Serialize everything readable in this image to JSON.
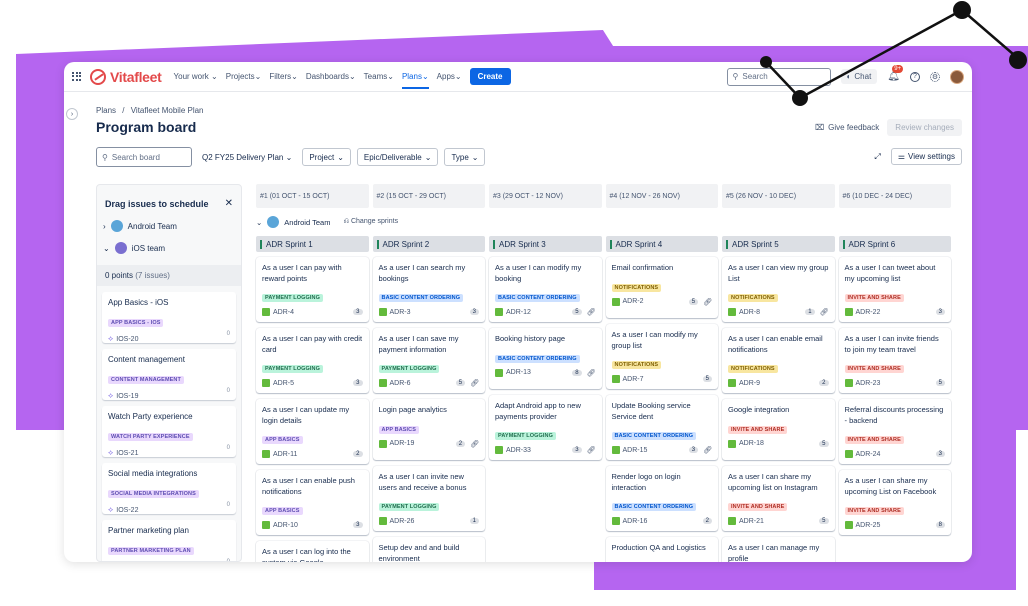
{
  "brand": {
    "name": "Vitafleet",
    "accent": "#e3494a",
    "primary": "#0c66e4",
    "backdrop": "#b565f0"
  },
  "nav": {
    "items": [
      "Your work",
      "Projects",
      "Filters",
      "Dashboards",
      "Teams",
      "Plans",
      "Apps"
    ],
    "active_index": 5,
    "create_label": "Create",
    "search_placeholder": "Search",
    "chat_label": "Chat",
    "notification_badge": "9+"
  },
  "breadcrumb": {
    "plans": "Plans",
    "separator": "/",
    "plan": "Vitafleet Mobile Plan"
  },
  "page_title": "Program board",
  "header_actions": {
    "feedback": "Give feedback",
    "review": "Review changes"
  },
  "filters": {
    "search_placeholder": "Search board",
    "plan": "Q2 FY25 Delivery Plan",
    "project": "Project",
    "epic": "Epic/Deliverable",
    "type": "Type",
    "view_settings": "View settings"
  },
  "sidebar": {
    "title": "Drag issues to schedule",
    "teams": [
      "Android Team",
      "iOS team"
    ],
    "points": "0 points",
    "issue_count": "(7 issues)",
    "issues": [
      {
        "title": "App Basics - iOS",
        "tag": "APP BASICS - IOS",
        "key": "IOS-20",
        "count": "0"
      },
      {
        "title": "Content management",
        "tag": "CONTENT MANAGEMENT",
        "key": "IOS-19",
        "count": "0"
      },
      {
        "title": "Watch Party experience",
        "tag": "WATCH PARTY EXPERIENCE",
        "key": "IOS-21",
        "count": "0"
      },
      {
        "title": "Social media integrations",
        "tag": "SOCIAL MEDIA INTEGRATIONS",
        "key": "IOS-22",
        "count": "0"
      },
      {
        "title": "Partner marketing plan",
        "tag": "PARTNER MARKETING PLAN",
        "key": "IOS-1",
        "count": "0"
      }
    ]
  },
  "board": {
    "sprint_ranges": [
      "#1 (01 OCT - 15 OCT)",
      "#2 (15 OCT - 29 OCT)",
      "#3 (29 OCT - 12 NOV)",
      "#4 (12 NOV - 26 NOV)",
      "#5 (26 NOV - 10 DEC)",
      "#6 (10 DEC - 24 DEC)"
    ],
    "team": "Android Team",
    "change_sprints": "Change sprints",
    "columns": [
      {
        "name": "ADR Sprint 1",
        "cards": [
          {
            "title": "As a user I can pay with reward points",
            "tag": "PAYMENT LOGGING",
            "color": "green",
            "key": "ADR-4",
            "pts": "3",
            "link": false
          },
          {
            "title": "As a user I can pay with credit card",
            "tag": "PAYMENT LOGGING",
            "color": "green",
            "key": "ADR-5",
            "pts": "3",
            "link": false
          },
          {
            "title": "As a user I can update my login details",
            "tag": "APP BASICS",
            "color": "purple",
            "key": "ADR-11",
            "pts": "2",
            "link": false
          },
          {
            "title": "As a user I can enable push notifications",
            "tag": "APP BASICS",
            "color": "purple",
            "key": "ADR-10",
            "pts": "3",
            "link": false
          },
          {
            "title": "As a user I can log into the system via Google",
            "tag": "",
            "color": "purple",
            "key": "",
            "pts": "",
            "link": false
          }
        ]
      },
      {
        "name": "ADR Sprint 2",
        "cards": [
          {
            "title": "As a user I can search my bookings",
            "tag": "BASIC CONTENT ORDERING",
            "color": "blue",
            "key": "ADR-3",
            "pts": "3",
            "link": false
          },
          {
            "title": "As a user I can save my payment information",
            "tag": "PAYMENT LOGGING",
            "color": "green",
            "key": "ADR-6",
            "pts": "5",
            "link": true
          },
          {
            "title": "Login page analytics",
            "tag": "APP BASICS",
            "color": "purple",
            "key": "ADR-19",
            "pts": "2",
            "link": true
          },
          {
            "title": "As a user I can invite new users and receive a bonus",
            "tag": "PAYMENT LOGGING",
            "color": "green",
            "key": "ADR-26",
            "pts": "1",
            "link": false
          },
          {
            "title": "Setup dev and and build environment",
            "tag": "",
            "color": "green",
            "key": "",
            "pts": "",
            "link": false
          }
        ]
      },
      {
        "name": "ADR Sprint 3",
        "cards": [
          {
            "title": "As a user I can modify my booking",
            "tag": "BASIC CONTENT ORDERING",
            "color": "blue",
            "key": "ADR-12",
            "pts": "5",
            "link": true
          },
          {
            "title": "Booking history page",
            "tag": "BASIC CONTENT ORDERING",
            "color": "blue",
            "key": "ADR-13",
            "pts": "8",
            "link": true
          },
          {
            "title": "Adapt Android app to new payments provider",
            "tag": "PAYMENT LOGGING",
            "color": "green",
            "key": "ADR-33",
            "pts": "3",
            "link": true
          }
        ]
      },
      {
        "name": "ADR Sprint 4",
        "cards": [
          {
            "title": "Email confirmation",
            "tag": "NOTIFICATIONS",
            "color": "yellow",
            "key": "ADR-2",
            "pts": "5",
            "link": true
          },
          {
            "title": "As a user I can modify my group list",
            "tag": "NOTIFICATIONS",
            "color": "yellow",
            "key": "ADR-7",
            "pts": "5",
            "link": false
          },
          {
            "title": "Update Booking service Service dent",
            "tag": "BASIC CONTENT ORDERING",
            "color": "blue",
            "key": "ADR-15",
            "pts": "3",
            "link": true
          },
          {
            "title": "Render logo on login interaction",
            "tag": "BASIC CONTENT ORDERING",
            "color": "blue",
            "key": "ADR-16",
            "pts": "2",
            "link": false
          },
          {
            "title": "Production QA and Logistics",
            "tag": "BASIC CONTENT ORDERING",
            "color": "blue",
            "key": "",
            "pts": "",
            "link": false
          }
        ]
      },
      {
        "name": "ADR Sprint 5",
        "cards": [
          {
            "title": "As a user I can view my group List",
            "tag": "NOTIFICATIONS",
            "color": "yellow",
            "key": "ADR-8",
            "pts": "1",
            "link": true
          },
          {
            "title": "As a user I can enable email notifications",
            "tag": "NOTIFICATIONS",
            "color": "yellow",
            "key": "ADR-9",
            "pts": "2",
            "link": false
          },
          {
            "title": "Google integration",
            "tag": "INVITE AND SHARE",
            "color": "red",
            "key": "ADR-18",
            "pts": "5",
            "link": false
          },
          {
            "title": "As a user I can share my upcoming list on Instagram",
            "tag": "INVITE AND SHARE",
            "color": "red",
            "key": "ADR-21",
            "pts": "5",
            "link": false
          },
          {
            "title": "As a user I can manage my profile",
            "tag": "",
            "color": "red",
            "key": "",
            "pts": "",
            "link": false
          }
        ]
      },
      {
        "name": "ADR Sprint 6",
        "cards": [
          {
            "title": "As a user I can tweet about my upcoming list",
            "tag": "INVITE AND SHARE",
            "color": "red",
            "key": "ADR-22",
            "pts": "3",
            "link": false
          },
          {
            "title": "As a user I can invite friends to join my team travel",
            "tag": "INVITE AND SHARE",
            "color": "red",
            "key": "ADR-23",
            "pts": "5",
            "link": false
          },
          {
            "title": "Referral discounts processing - backend",
            "tag": "INVITE AND SHARE",
            "color": "red",
            "key": "ADR-24",
            "pts": "3",
            "link": false
          },
          {
            "title": "As a user I can share my upcoming List on Facebook",
            "tag": "INVITE AND SHARE",
            "color": "red",
            "key": "ADR-25",
            "pts": "8",
            "link": false
          }
        ]
      }
    ]
  }
}
